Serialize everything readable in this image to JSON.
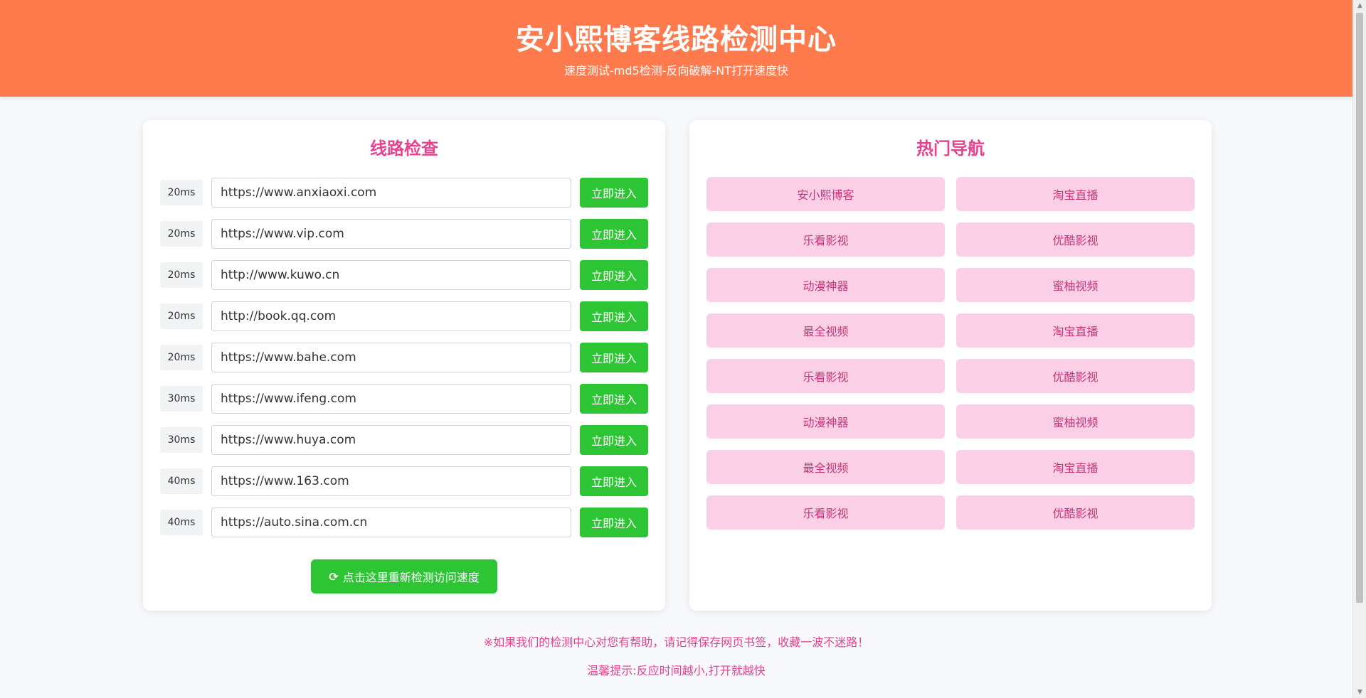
{
  "header": {
    "title": "安小熙博客线路检测中心",
    "subtitle": "速度测试-md5检测-反向破解-NT打开速度快"
  },
  "route_panel": {
    "title": "线路检查",
    "enter_label": "立即进入",
    "routes": [
      {
        "latency": "20ms",
        "url": "https://www.anxiaoxi.com"
      },
      {
        "latency": "20ms",
        "url": "https://www.vip.com"
      },
      {
        "latency": "20ms",
        "url": "http://www.kuwo.cn"
      },
      {
        "latency": "20ms",
        "url": "http://book.qq.com"
      },
      {
        "latency": "20ms",
        "url": "https://www.bahe.com"
      },
      {
        "latency": "30ms",
        "url": "https://www.ifeng.com"
      },
      {
        "latency": "30ms",
        "url": "https://www.huya.com"
      },
      {
        "latency": "40ms",
        "url": "https://www.163.com"
      },
      {
        "latency": "40ms",
        "url": "https://auto.sina.com.cn"
      }
    ],
    "recheck_label": "点击这里重新检测访问速度",
    "recheck_icon": "refresh-icon"
  },
  "nav_panel": {
    "title": "热门导航",
    "items": [
      "安小熙博客",
      "淘宝直播",
      "乐看影视",
      "优酷影视",
      "动漫神器",
      "蜜柚视频",
      "最全视频",
      "淘宝直播",
      "乐看影视",
      "优酷影视",
      "动漫神器",
      "蜜柚视频",
      "最全视频",
      "淘宝直播",
      "乐看影视",
      "优酷影视"
    ]
  },
  "footer": {
    "note": "※如果我们的检测中心对您有帮助，请记得保存网页书签，收藏一波不迷路！",
    "tip": "温馨提示:反应时间越小,打开就越快"
  },
  "colors": {
    "header_bg": "#ff7b4e",
    "accent_pink": "#e8418f",
    "nav_bg": "#fbd0e6",
    "nav_text": "#c2377a",
    "green": "#2ec535"
  }
}
